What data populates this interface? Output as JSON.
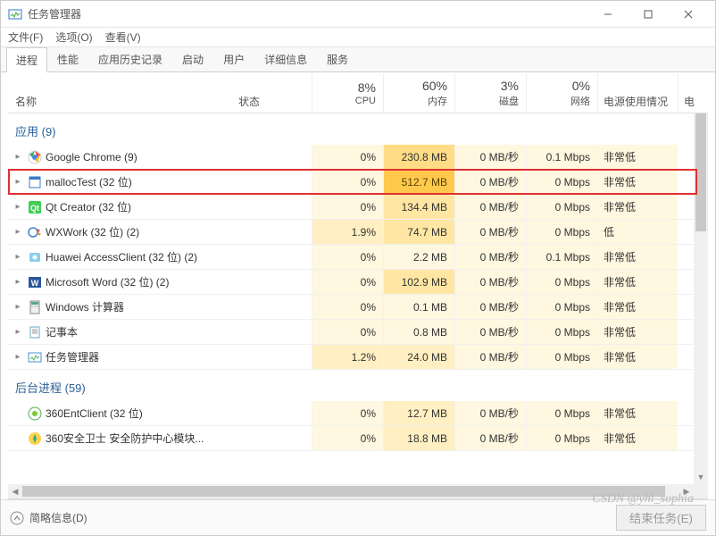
{
  "window": {
    "title": "任务管理器"
  },
  "menu": {
    "file": "文件(F)",
    "options": "选项(O)",
    "view": "查看(V)"
  },
  "tabs": [
    "进程",
    "性能",
    "应用历史记录",
    "启动",
    "用户",
    "详细信息",
    "服务"
  ],
  "activeTab": 0,
  "columns": {
    "name": "名称",
    "status": "状态",
    "cpu": {
      "pct": "8%",
      "label": "CPU"
    },
    "memory": {
      "pct": "60%",
      "label": "内存"
    },
    "disk": {
      "pct": "3%",
      "label": "磁盘"
    },
    "network": {
      "pct": "0%",
      "label": "网络"
    },
    "power": "电源使用情况",
    "extra": "电"
  },
  "sections": {
    "apps": {
      "label": "应用 (9)"
    },
    "background": {
      "label": "后台进程 (59)"
    }
  },
  "apps": [
    {
      "icon": "chrome",
      "name": "Google Chrome (9)",
      "cpu": "0%",
      "cpuHeat": 0,
      "mem": "230.8 MB",
      "memHeat": 3,
      "disk": "0 MB/秒",
      "diskHeat": 0,
      "net": "0.1 Mbps",
      "netHeat": 0,
      "power": "非常低"
    },
    {
      "icon": "app",
      "name": "mallocTest (32 位)",
      "cpu": "0%",
      "cpuHeat": 0,
      "mem": "512.7 MB",
      "memHeat": 4,
      "disk": "0 MB/秒",
      "diskHeat": 0,
      "net": "0 Mbps",
      "netHeat": 0,
      "power": "非常低",
      "highlight": true
    },
    {
      "icon": "qt",
      "name": "Qt Creator (32 位)",
      "cpu": "0%",
      "cpuHeat": 0,
      "mem": "134.4 MB",
      "memHeat": 2,
      "disk": "0 MB/秒",
      "diskHeat": 0,
      "net": "0 Mbps",
      "netHeat": 0,
      "power": "非常低"
    },
    {
      "icon": "wxwork",
      "name": "WXWork (32 位) (2)",
      "cpu": "1.9%",
      "cpuHeat": 1,
      "mem": "74.7 MB",
      "memHeat": 2,
      "disk": "0 MB/秒",
      "diskHeat": 0,
      "net": "0 Mbps",
      "netHeat": 0,
      "power": "低"
    },
    {
      "icon": "huawei",
      "name": "Huawei AccessClient (32 位) (2)",
      "cpu": "0%",
      "cpuHeat": 0,
      "mem": "2.2 MB",
      "memHeat": 0,
      "disk": "0 MB/秒",
      "diskHeat": 0,
      "net": "0.1 Mbps",
      "netHeat": 0,
      "power": "非常低"
    },
    {
      "icon": "word",
      "name": "Microsoft Word (32 位) (2)",
      "cpu": "0%",
      "cpuHeat": 0,
      "mem": "102.9 MB",
      "memHeat": 2,
      "disk": "0 MB/秒",
      "diskHeat": 0,
      "net": "0 Mbps",
      "netHeat": 0,
      "power": "非常低"
    },
    {
      "icon": "calc",
      "name": "Windows 计算器",
      "cpu": "0%",
      "cpuHeat": 0,
      "mem": "0.1 MB",
      "memHeat": 0,
      "disk": "0 MB/秒",
      "diskHeat": 0,
      "net": "0 Mbps",
      "netHeat": 0,
      "power": "非常低"
    },
    {
      "icon": "notepad",
      "name": "记事本",
      "cpu": "0%",
      "cpuHeat": 0,
      "mem": "0.8 MB",
      "memHeat": 0,
      "disk": "0 MB/秒",
      "diskHeat": 0,
      "net": "0 Mbps",
      "netHeat": 0,
      "power": "非常低"
    },
    {
      "icon": "taskmgr",
      "name": "任务管理器",
      "cpu": "1.2%",
      "cpuHeat": 1,
      "mem": "24.0 MB",
      "memHeat": 1,
      "disk": "0 MB/秒",
      "diskHeat": 0,
      "net": "0 Mbps",
      "netHeat": 0,
      "power": "非常低"
    }
  ],
  "background": [
    {
      "icon": "360",
      "name": "360EntClient (32 位)",
      "cpu": "0%",
      "cpuHeat": 0,
      "mem": "12.7 MB",
      "memHeat": 1,
      "disk": "0 MB/秒",
      "diskHeat": 0,
      "net": "0 Mbps",
      "netHeat": 0,
      "power": "非常低",
      "expandable": false
    },
    {
      "icon": "360s",
      "name": "360安全卫士 安全防护中心模块...",
      "cpu": "0%",
      "cpuHeat": 0,
      "mem": "18.8 MB",
      "memHeat": 1,
      "disk": "0 MB/秒",
      "diskHeat": 0,
      "net": "0 Mbps",
      "netHeat": 0,
      "power": "非常低",
      "expandable": false
    }
  ],
  "statusbar": {
    "fewer": "简略信息(D)",
    "endTask": "结束任务(E)"
  },
  "watermark": "CSDN @yhl_sophia"
}
